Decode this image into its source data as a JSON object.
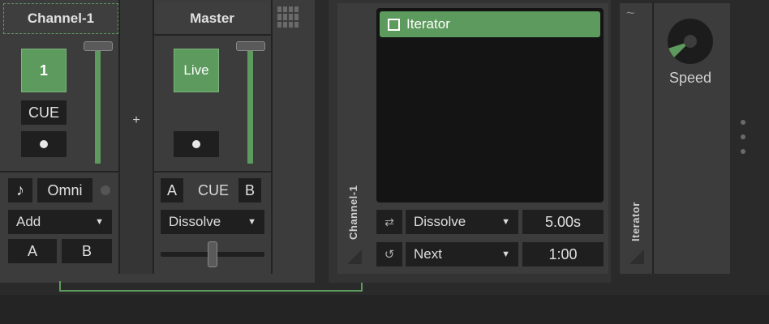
{
  "mixer": {
    "channel1": {
      "title": "Channel-1",
      "number_label": "1",
      "cue_label": "CUE",
      "midi_label": "Omni",
      "blend_mode": "Add",
      "a_label": "A",
      "b_label": "B"
    },
    "plus_label": "+",
    "master": {
      "title": "Master",
      "live_label": "Live",
      "a_label": "A",
      "cue_label": "CUE",
      "b_label": "B",
      "transition": "Dissolve"
    }
  },
  "clips": {
    "side_label": "Channel-1",
    "items": [
      {
        "label": "Iterator",
        "selected": true
      }
    ],
    "transition": "Dissolve",
    "duration": "5.00s",
    "order": "Next",
    "time": "1:00"
  },
  "effect": {
    "side_label": "Iterator",
    "wave_symbol": "~",
    "knob_label": "Speed",
    "knob_value_fraction": 0.1
  },
  "icons": {
    "note": "music-note-icon",
    "grid": "grid-icon",
    "shuffle": "shuffle-icon",
    "loop": "loop-icon",
    "more": "vertical-dots-icon"
  },
  "colors": {
    "accent": "#5d9a5d",
    "panel": "#3c3c3c",
    "control": "#1f1f1f",
    "background": "#2a2a2a"
  }
}
